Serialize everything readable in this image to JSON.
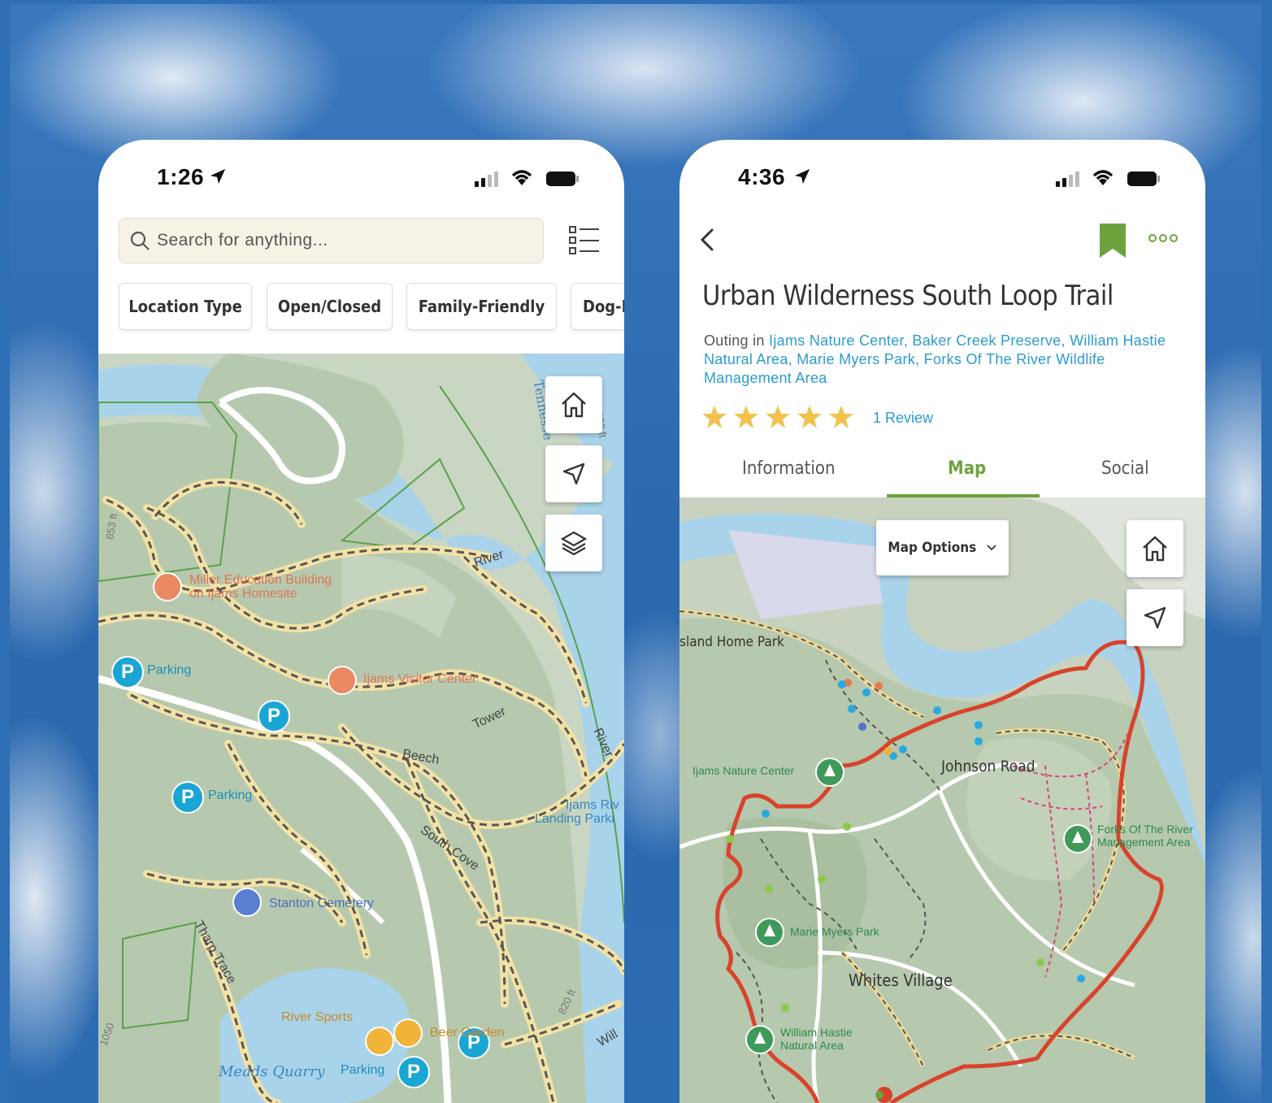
{
  "left_phone": {
    "status": {
      "time": "1:26"
    },
    "search": {
      "placeholder": "Search for anything..."
    },
    "filters": [
      "Location Type",
      "Open/Closed",
      "Family-Friendly",
      "Dog-F"
    ],
    "map": {
      "labels": {
        "miller1": "Miller Education Building",
        "miller2": "on Ijams Homesite",
        "parking1": "Parking",
        "visitor": "Ijams Visitor Center",
        "parking2": "Parking",
        "stanton": "Stanton Cemetery",
        "river_sports": "River Sports",
        "beer_garden": "Beer Garden",
        "meads": "Meads Quarry",
        "parking3": "Parking",
        "river_top": "River",
        "tower": "Tower",
        "beech": "Beech",
        "south_cove": "South Cove",
        "river_side": "River",
        "tennessee": "Tennesse",
        "ft820a": "820 ft",
        "ft820b": "820 ft",
        "landing1": "Ijams Riv",
        "landing2": "Landing Parki",
        "tharp": "Tharp Trace",
        "ft853": "853 ft",
        "ft1050": "1050",
        "will": "Will"
      },
      "controls": [
        "home-icon",
        "navigate-icon",
        "layers-icon"
      ]
    }
  },
  "right_phone": {
    "status": {
      "time": "4:36"
    },
    "title": "Urban Wilderness South Loop Trail",
    "outing_prefix": "Outing in ",
    "outing_places": "Ijams Nature Center, Baker Creek Preserve, William Hastie Natural Area, Marie Myers Park, Forks Of The River Wildlife Management Area",
    "rating": 5,
    "review_count": "1 Review",
    "tabs": [
      {
        "label": "Information",
        "active": false
      },
      {
        "label": "Map",
        "active": true
      },
      {
        "label": "Social",
        "active": false
      }
    ],
    "accent_color": "#6ea23f",
    "link_color": "#2c9bd1",
    "map": {
      "options_label": "Map Options",
      "labels": {
        "island_home": "sland Home Park",
        "ijams": "Ijams Nature Center",
        "johnson": "Johnson Road",
        "forks1": "Forks Of The River",
        "forks2": "Management Area",
        "marie": "Marie Myers Park",
        "whites": "Whites Village",
        "hastie1": "William Hastie",
        "hastie2": "Natural Area"
      },
      "trail_color": "#d8432c"
    }
  }
}
